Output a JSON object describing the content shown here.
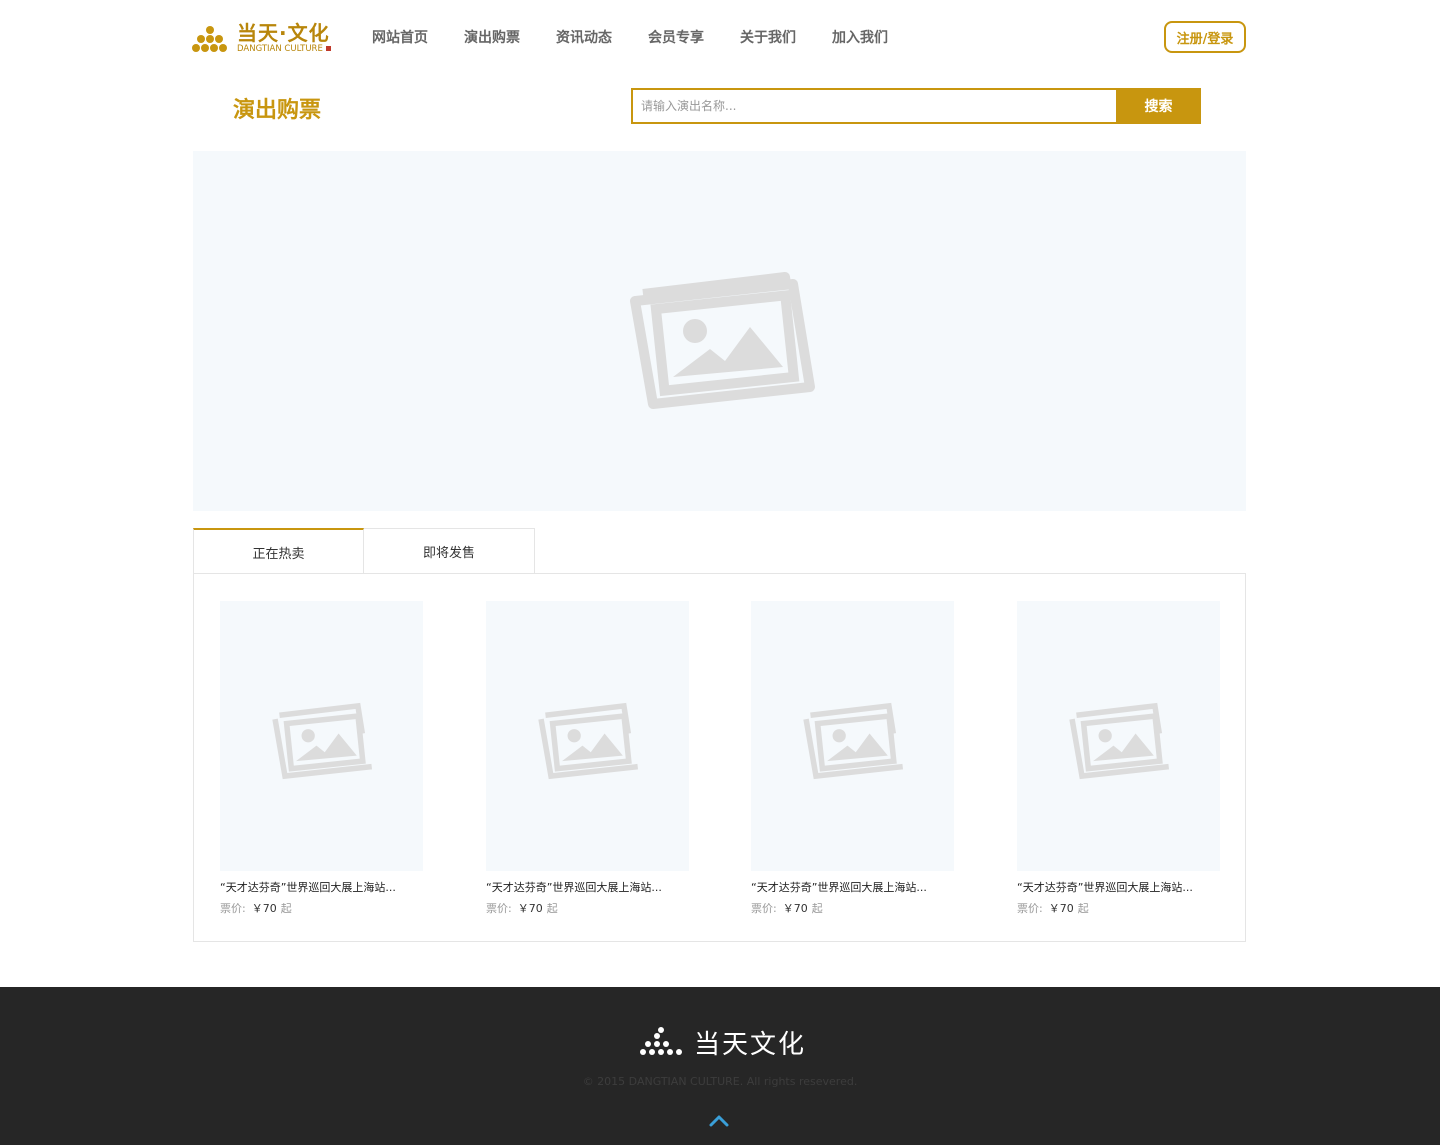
{
  "header": {
    "logo_cn": "当天·文化",
    "logo_en": "DANGTIAN CULTURE",
    "nav": [
      "网站首页",
      "演出购票",
      "资讯动态",
      "会员专享",
      "关于我们",
      "加入我们"
    ],
    "login_label": "注册/登录"
  },
  "page": {
    "title": "演出购票",
    "search_placeholder": "请输入演出名称...",
    "search_button": "搜索"
  },
  "banner": {
    "icon": "image-placeholder-icon"
  },
  "tabs": [
    "正在热卖",
    "即将发售"
  ],
  "products": [
    {
      "title": "“天才达芬奇”世界巡回大展上海站...",
      "price_label": "票价:",
      "price": "￥70",
      "suffix": "起"
    },
    {
      "title": "“天才达芬奇”世界巡回大展上海站...",
      "price_label": "票价:",
      "price": "￥70",
      "suffix": "起"
    },
    {
      "title": "“天才达芬奇”世界巡回大展上海站...",
      "price_label": "票价:",
      "price": "￥70",
      "suffix": "起"
    },
    {
      "title": "“天才达芬奇”世界巡回大展上海站...",
      "price_label": "票价:",
      "price": "￥70",
      "suffix": "起"
    }
  ],
  "footer": {
    "name": "当天文化",
    "copyright": "© 2015 DANGTIAN CULTURE. All rights resevered."
  },
  "colors": {
    "accent": "#c8960f",
    "footer_bg": "#262626",
    "placeholder_bg": "#f5f9fc",
    "back_top": "#3a9fd8"
  }
}
